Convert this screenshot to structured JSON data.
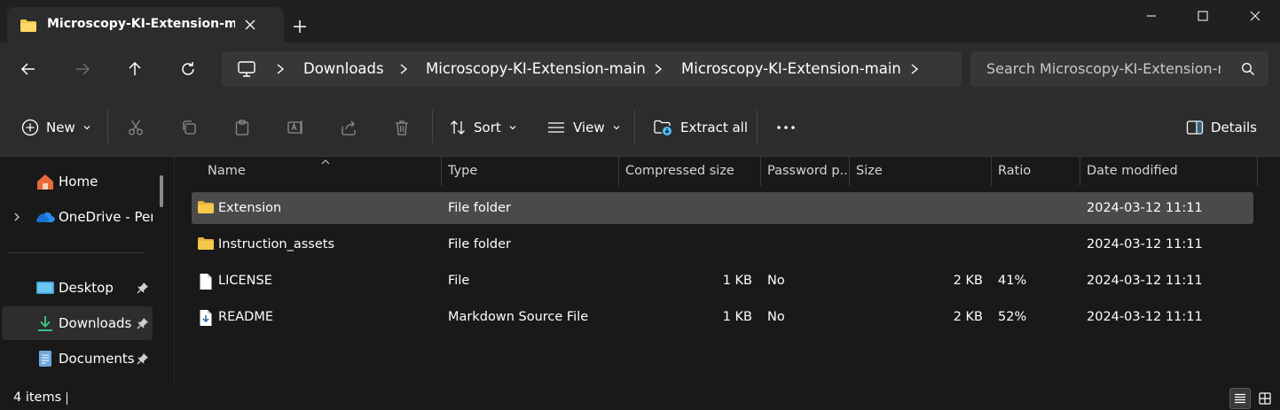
{
  "tab": {
    "title": "Microscopy-KI-Extension-main"
  },
  "breadcrumbs": [
    "Downloads",
    "Microscopy-KI-Extension-main",
    "Microscopy-KI-Extension-main"
  ],
  "search": {
    "placeholder": "Search Microscopy-KI-Extension-main"
  },
  "toolbar": {
    "new_label": "New",
    "sort_label": "Sort",
    "view_label": "View",
    "extract_label": "Extract all",
    "details_label": "Details"
  },
  "sidebar": {
    "items": [
      {
        "label": "Home",
        "icon": "home-icon"
      },
      {
        "label": "OneDrive - Personal",
        "icon": "onedrive-icon"
      },
      {
        "label": "Desktop",
        "icon": "desktop-icon"
      },
      {
        "label": "Downloads",
        "icon": "downloads-icon"
      },
      {
        "label": "Documents",
        "icon": "documents-icon"
      }
    ]
  },
  "columns": [
    "Name",
    "Type",
    "Compressed size",
    "Password p...",
    "Size",
    "Ratio",
    "Date modified"
  ],
  "files": [
    {
      "name": "Extension",
      "type": "File folder",
      "compressed": "",
      "password": "",
      "size": "",
      "ratio": "",
      "date": "2024-03-12 11:11",
      "icon": "folder-icon"
    },
    {
      "name": "Instruction_assets",
      "type": "File folder",
      "compressed": "",
      "password": "",
      "size": "",
      "ratio": "",
      "date": "2024-03-12 11:11",
      "icon": "folder-icon"
    },
    {
      "name": "LICENSE",
      "type": "File",
      "compressed": "1 KB",
      "password": "No",
      "size": "2 KB",
      "ratio": "41%",
      "date": "2024-03-12 11:11",
      "icon": "file-icon"
    },
    {
      "name": "README",
      "type": "Markdown Source File",
      "compressed": "1 KB",
      "password": "No",
      "size": "2 KB",
      "ratio": "52%",
      "date": "2024-03-12 11:11",
      "icon": "markdown-file-icon"
    }
  ],
  "status": {
    "count": "4 items"
  },
  "colors": {
    "folder": "#f5c84c",
    "accent": "#4cc2ff",
    "selection": "#4a4a4a"
  }
}
